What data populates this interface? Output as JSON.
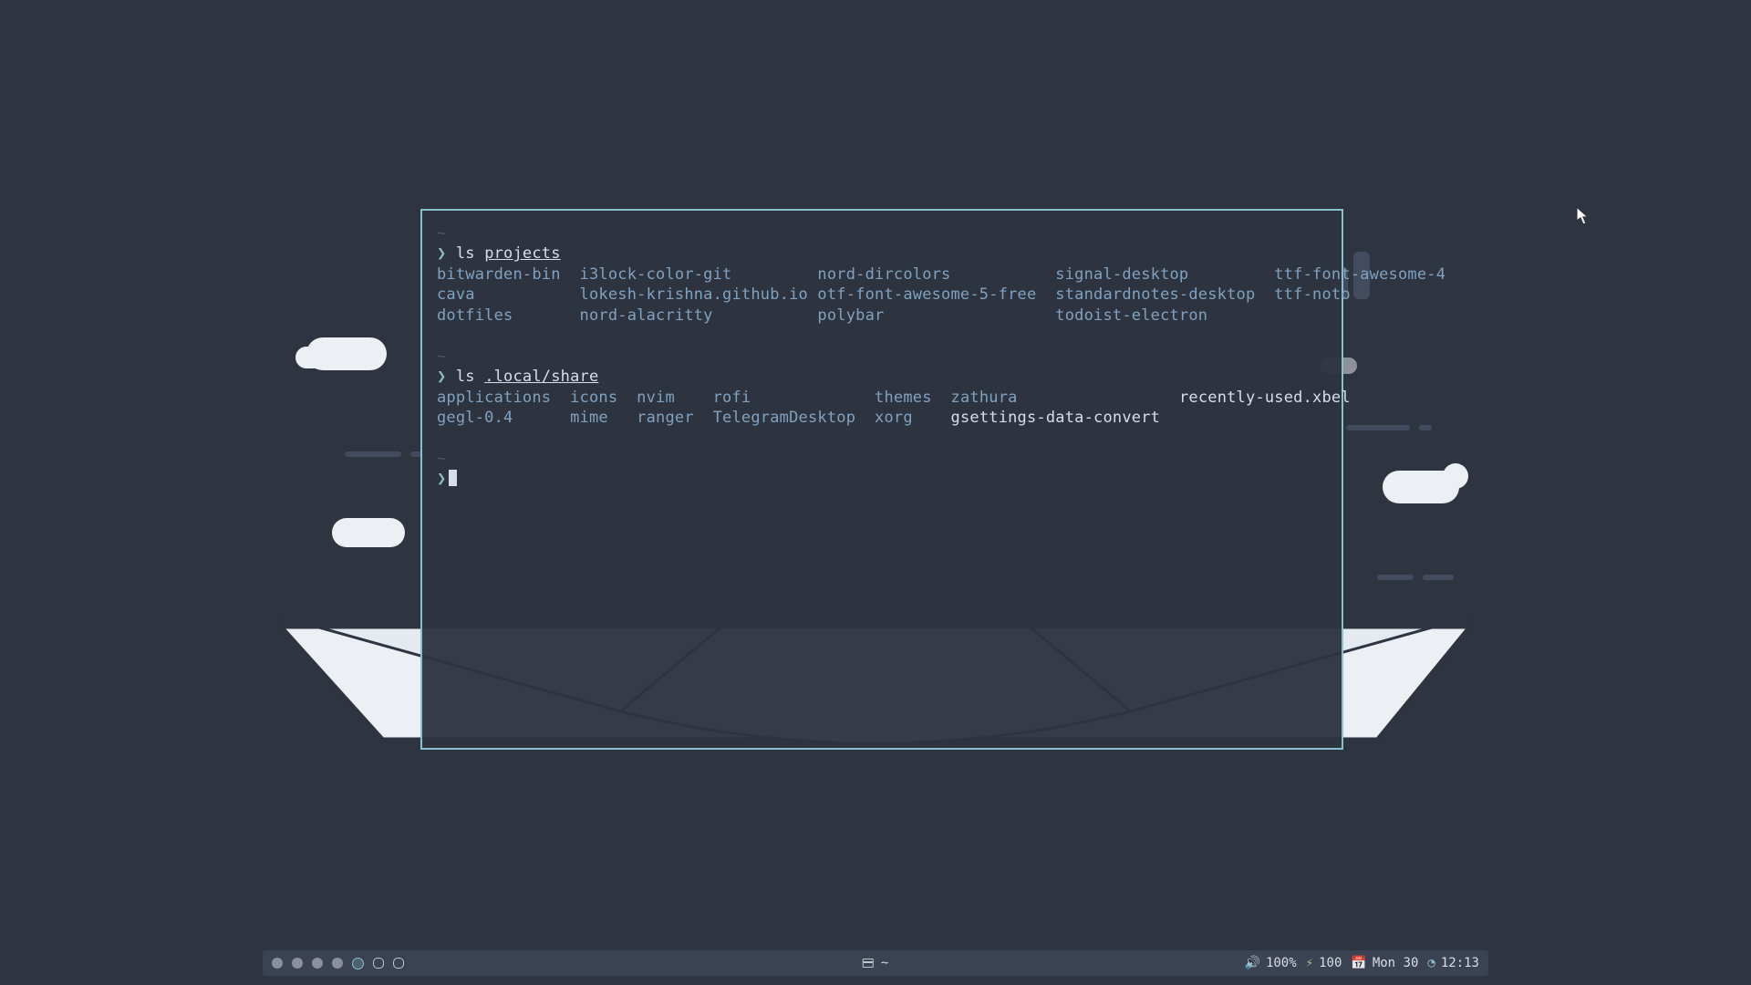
{
  "terminal": {
    "block1": {
      "tilde": "~",
      "prompt": "❯",
      "command": "ls",
      "path": "projects",
      "rows": [
        [
          "bitwarden-bin",
          "i3lock-color-git",
          "nord-dircolors",
          "signal-desktop",
          "ttf-font-awesome-4"
        ],
        [
          "cava",
          "lokesh-krishna.github.io",
          "otf-font-awesome-5-free",
          "standardnotes-desktop",
          "ttf-noto"
        ],
        [
          "dotfiles",
          "nord-alacritty",
          "polybar",
          "todoist-electron",
          ""
        ]
      ]
    },
    "block2": {
      "tilde": "~",
      "prompt": "❯",
      "command": "ls",
      "path": ".local/share",
      "rows": [
        [
          "applications",
          "icons",
          "nvim",
          "rofi",
          "themes",
          "zathura",
          "recently-used.xbel"
        ],
        [
          "gegl-0.4",
          "mime",
          "ranger",
          "TelegramDesktop",
          "xorg",
          "gsettings-data-convert",
          ""
        ]
      ],
      "file_items": [
        "recently-used.xbel",
        "gsettings-data-convert"
      ]
    },
    "block3": {
      "tilde": "~",
      "prompt": "❯"
    }
  },
  "bar": {
    "workspaces": [
      {
        "state": "occupied"
      },
      {
        "state": "occupied"
      },
      {
        "state": "occupied"
      },
      {
        "state": "occupied"
      },
      {
        "state": "focused"
      },
      {
        "state": "empty"
      },
      {
        "state": "empty"
      }
    ],
    "window_title": "~",
    "volume": {
      "glyph": "🔊",
      "value": "100%"
    },
    "battery": {
      "glyph": "⚡",
      "value": "100"
    },
    "date": {
      "glyph": "📅",
      "value": "Mon 30"
    },
    "clock": {
      "glyph": "◔",
      "value": "12:13"
    }
  }
}
